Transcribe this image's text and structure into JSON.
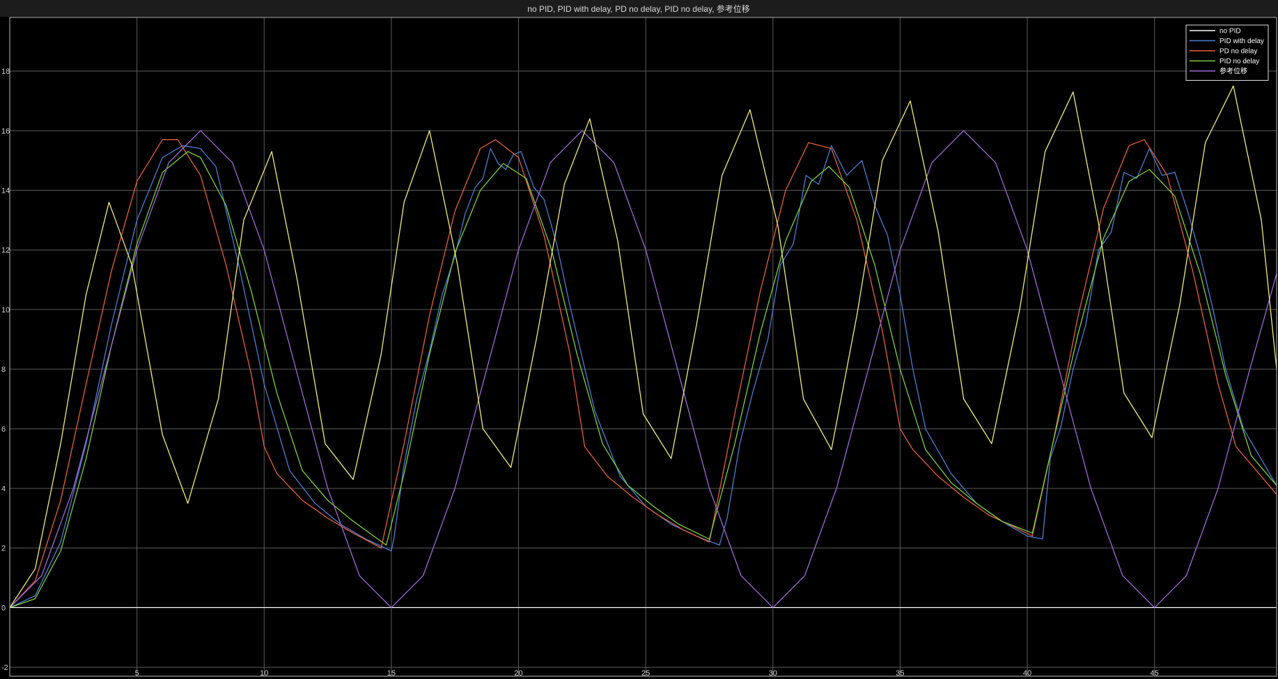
{
  "window": {
    "title": "no PID, PID with delay, PD no delay, PID no delay, 参考位移"
  },
  "colors": {
    "background": "#000000",
    "titlebar": "#1c1c1c",
    "grid": "#5c5c5c",
    "axes_border": "#bdbdbd",
    "tick_text": "#cfcfcf"
  },
  "chart_data": {
    "type": "line",
    "title": "no PID, PID with delay, PD no delay, PID no delay, 参考位移",
    "xlabel": "",
    "ylabel": "",
    "xlim": [
      0,
      49.8
    ],
    "ylim": [
      -2.3,
      19.8
    ],
    "xticks": [
      5,
      10,
      15,
      20,
      25,
      30,
      35,
      40,
      45
    ],
    "yticks": [
      -2,
      0,
      2,
      4,
      6,
      8,
      10,
      12,
      14,
      16,
      18
    ],
    "grid": true,
    "legend_position": "top-right",
    "series": [
      {
        "name": "no PID",
        "color": "#ffffff",
        "x": [
          0,
          49.8
        ],
        "y": [
          0,
          0
        ]
      },
      {
        "name": "PID with delay",
        "color": "#4a7fd4",
        "x": [
          0,
          1,
          2,
          3,
          4,
          5,
          6,
          6.8,
          7.5,
          8.1,
          9,
          10,
          11,
          12,
          13,
          14,
          15,
          15.1,
          15.5,
          16,
          16.5,
          17,
          17.5,
          17.9,
          18.3,
          18.6,
          18.9,
          19.2,
          19.5,
          19.8,
          20.1,
          20.6,
          21,
          21.5,
          22,
          22.5,
          23,
          24,
          25,
          26,
          27,
          27.9,
          28.2,
          28.7,
          29.2,
          29.8,
          30.3,
          30.8,
          31.3,
          31.8,
          32.3,
          32.9,
          33.5,
          34,
          34.5,
          35,
          35.5,
          36,
          37,
          38,
          39,
          40,
          40.6,
          40.9,
          41.3,
          41.8,
          42.3,
          42.8,
          43.3,
          43.8,
          44.3,
          44.8,
          45.3,
          45.8,
          46.3,
          46.8,
          47.3,
          47.8,
          48.5,
          49.8
        ],
        "y": [
          0,
          0.4,
          2.2,
          5.5,
          9.5,
          13,
          15.1,
          15.5,
          15.4,
          14.8,
          11.5,
          7.5,
          4.6,
          3.5,
          2.8,
          2.3,
          1.9,
          2.3,
          4.8,
          7,
          8.6,
          10.5,
          11.8,
          13.2,
          14.1,
          14.4,
          15.4,
          14.9,
          14.7,
          15.2,
          15.3,
          14.1,
          13.7,
          12.2,
          10.2,
          8.4,
          6.6,
          4.4,
          3.4,
          2.8,
          2.4,
          2.1,
          3,
          5.5,
          7.2,
          9,
          11.5,
          12.2,
          14.5,
          14.2,
          15.5,
          14.5,
          15,
          13.5,
          12.5,
          10.5,
          8,
          6,
          4.5,
          3.5,
          2.9,
          2.4,
          2.3,
          5,
          6,
          8,
          9.5,
          12,
          12.6,
          14.6,
          14.4,
          15.4,
          14.5,
          14.6,
          13.3,
          11.8,
          10,
          8,
          6,
          4.1
        ]
      },
      {
        "name": "PD no delay",
        "color": "#e8603c",
        "x": [
          0,
          1,
          2,
          3,
          4,
          5,
          6,
          6.6,
          7.5,
          8.5,
          9.5,
          10,
          10.5,
          11.5,
          12.5,
          13.5,
          14.6,
          15.5,
          16.5,
          17.5,
          18.5,
          19.1,
          20,
          21,
          22,
          22.6,
          23.5,
          24.5,
          25.5,
          26.5,
          27.5,
          28.5,
          29.5,
          30.5,
          31.4,
          32.3,
          33.3,
          34.3,
          35,
          35.5,
          36.5,
          37.5,
          38.5,
          39.5,
          40.2,
          41,
          42,
          43,
          44,
          44.6,
          45.5,
          46.5,
          47.5,
          48.2,
          49,
          49.8
        ],
        "y": [
          0,
          0.9,
          3.6,
          7.5,
          11.3,
          14.3,
          15.7,
          15.7,
          14.5,
          11.5,
          7.8,
          5.4,
          4.5,
          3.6,
          3,
          2.5,
          2,
          5.5,
          9.8,
          13.3,
          15.4,
          15.7,
          15.1,
          12.5,
          8.6,
          5.4,
          4.4,
          3.7,
          3.1,
          2.6,
          2.2,
          6.5,
          10.6,
          14,
          15.6,
          15.4,
          13,
          9.3,
          6,
          5.3,
          4.4,
          3.7,
          3.1,
          2.7,
          2.4,
          5.5,
          9.8,
          13.4,
          15.5,
          15.7,
          14.5,
          11.3,
          7.5,
          5.4,
          4.6,
          3.8
        ]
      },
      {
        "name": "PID no delay",
        "color": "#7fd13c",
        "x": [
          0,
          1,
          2,
          3,
          4,
          5,
          6,
          7,
          7.5,
          8.5,
          9.5,
          10.5,
          11.5,
          12.5,
          13.5,
          14.8,
          15.5,
          16.5,
          17.5,
          18.5,
          19.4,
          20.3,
          21.3,
          22.3,
          23.3,
          24.3,
          25.3,
          26.3,
          27.5,
          28.5,
          29.5,
          30.5,
          31.5,
          32.2,
          33,
          34,
          35,
          36,
          37,
          38,
          39,
          40.2,
          41,
          42,
          43,
          44,
          44.8,
          45.8,
          46.8,
          47.8,
          48.8,
          49.8
        ],
        "y": [
          0,
          0.3,
          1.9,
          5,
          8.8,
          12.2,
          14.6,
          15.3,
          15.1,
          13.5,
          10.6,
          7.2,
          4.6,
          3.6,
          2.9,
          2.1,
          4.5,
          8.5,
          11.9,
          14,
          14.9,
          14.4,
          12,
          8.5,
          5.5,
          4.1,
          3.4,
          2.8,
          2.3,
          5.5,
          9.2,
          12.3,
          14.3,
          14.8,
          14.1,
          11.5,
          8,
          5.3,
          4.2,
          3.5,
          2.9,
          2.5,
          5.5,
          9.2,
          12.4,
          14.3,
          14.7,
          13.8,
          11.2,
          7.8,
          5.1,
          4.1
        ]
      },
      {
        "name": "参考位移",
        "color": "#a06ad9",
        "x": [
          0,
          1.25,
          2.5,
          3.75,
          5,
          6.25,
          7.5,
          8.75,
          10,
          11.25,
          12.5,
          13.75,
          15,
          16.25,
          17.5,
          18.75,
          20,
          21.25,
          22.5,
          23.75,
          25,
          26.25,
          27.5,
          28.75,
          30,
          31.25,
          32.5,
          33.75,
          35,
          36.25,
          37.5,
          38.75,
          40,
          41.25,
          42.5,
          43.75,
          45,
          46.25,
          47.5,
          48.75,
          49.8
        ],
        "y": [
          0,
          1.07,
          4,
          8,
          12,
          14.93,
          16,
          14.93,
          12,
          8,
          4,
          1.07,
          0,
          1.07,
          4,
          8,
          12,
          14.93,
          16,
          14.93,
          12,
          8,
          4,
          1.07,
          0,
          1.07,
          4,
          8,
          12,
          14.93,
          16,
          14.93,
          12,
          8,
          4,
          1.07,
          0,
          1.07,
          4,
          8,
          11.2
        ]
      },
      {
        "name": "",
        "color": "#f2ef7a",
        "x": [
          0,
          1,
          2,
          3,
          3.9,
          4.8,
          6,
          7,
          8.2,
          9.2,
          10.3,
          11.3,
          12.4,
          13.5,
          14.6,
          15.5,
          16.5,
          17.6,
          18.6,
          19.7,
          20.7,
          21.8,
          22.8,
          23.9,
          24.9,
          26,
          27,
          28,
          29.1,
          30.2,
          31.2,
          32.3,
          33.3,
          34.3,
          35.4,
          36.5,
          37.5,
          38.6,
          39.7,
          40.7,
          41.8,
          42.8,
          43.8,
          44.9,
          46,
          47,
          48.1,
          49.2,
          49.8
        ],
        "y": [
          0,
          1.3,
          5.5,
          10.5,
          13.6,
          11.5,
          5.8,
          3.5,
          7,
          13,
          15.3,
          11,
          5.5,
          4.3,
          8.5,
          13.6,
          16,
          11.5,
          6,
          4.7,
          9,
          14.2,
          16.4,
          12.3,
          6.5,
          5,
          9.5,
          14.5,
          16.7,
          12.8,
          7,
          5.3,
          9.8,
          15,
          17,
          12.6,
          7,
          5.5,
          10,
          15.3,
          17.3,
          12.9,
          7.2,
          5.7,
          10.2,
          15.6,
          17.5,
          13,
          8
        ]
      }
    ]
  }
}
